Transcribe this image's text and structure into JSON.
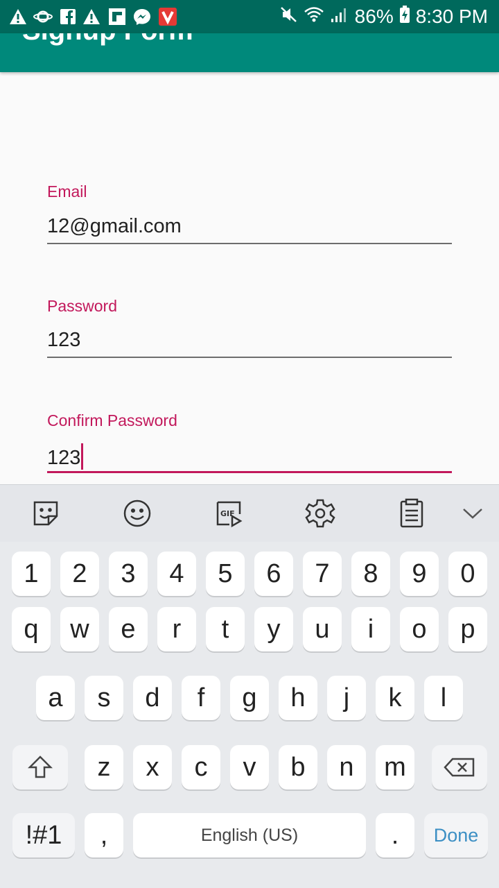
{
  "status_bar": {
    "battery": "86%",
    "time": "8:30 PM",
    "icons": [
      "warning-icon",
      "saturn-icon",
      "facebook-icon",
      "warning-icon",
      "flipboard-icon",
      "messenger-icon",
      "vivaldi-icon",
      "mute-icon",
      "wifi-icon",
      "signal-icon",
      "battery-icon"
    ]
  },
  "app_bar": {
    "title": "Signup Form"
  },
  "form": {
    "email_label": "Email",
    "email_value": "12@gmail.com",
    "password_label": "Password",
    "password_value": "123",
    "confirm_label": "Confirm Password",
    "confirm_value": "123"
  },
  "keyboard": {
    "toolbar": [
      "sticker-icon",
      "emoji-icon",
      "gif-icon",
      "settings-icon",
      "clipboard-icon",
      "collapse-icon"
    ],
    "rows": [
      [
        "1",
        "2",
        "3",
        "4",
        "5",
        "6",
        "7",
        "8",
        "9",
        "0"
      ],
      [
        "q",
        "w",
        "e",
        "r",
        "t",
        "y",
        "u",
        "i",
        "o",
        "p"
      ],
      [
        "a",
        "s",
        "d",
        "f",
        "g",
        "h",
        "j",
        "k",
        "l"
      ],
      [
        "z",
        "x",
        "c",
        "v",
        "b",
        "n",
        "m"
      ]
    ],
    "symbols_label": "!#1",
    "comma_label": ",",
    "space_label": "English (US)",
    "period_label": ".",
    "done_label": "Done",
    "colors": {
      "accent": "#c2185b",
      "app_bar": "#00897b",
      "status_bar": "#00695c",
      "done": "#3c8fc4"
    }
  }
}
